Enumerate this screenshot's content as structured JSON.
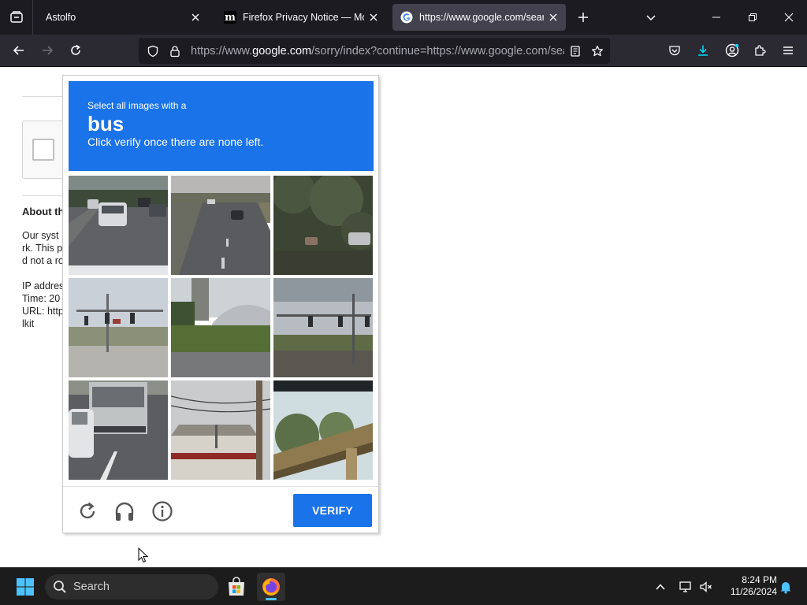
{
  "browser": {
    "tabs": [
      {
        "title": "Astolfo",
        "active": false
      },
      {
        "title": "Firefox Privacy Notice — Mozilla",
        "active": false
      },
      {
        "title": "https://www.google.com/search",
        "active": true
      }
    ],
    "url": {
      "prefix": "https://www.",
      "host": "google.com",
      "path": "/sorry/index?continue=https://www.google.com/search"
    }
  },
  "page_behind": {
    "heading": "About th",
    "lines": [
      "Our syst",
      "rk. This p",
      "d not a ro"
    ],
    "info_lines": [
      "IP addres",
      "Time: 20",
      "URL: http",
      "lkit"
    ]
  },
  "captcha": {
    "header": {
      "prompt": "Select all images with a",
      "target": "bus",
      "instruction": "Click verify once there are none left."
    },
    "tiles": [
      {
        "content": "street with cars"
      },
      {
        "content": "highway road"
      },
      {
        "content": "trees and cars"
      },
      {
        "content": "traffic lights intersection"
      },
      {
        "content": "grass and building"
      },
      {
        "content": "traffic lights street"
      },
      {
        "content": "bus rear"
      },
      {
        "content": "utility pole building"
      },
      {
        "content": "bridge overpass"
      }
    ],
    "footer": {
      "reload_icon": "reload-icon",
      "audio_icon": "headphones-icon",
      "info_icon": "info-icon",
      "verify_label": "VERIFY"
    },
    "colors": {
      "accent": "#1a73e8"
    }
  },
  "taskbar": {
    "search_label": "Search",
    "time": "8:24 PM",
    "date": "11/26/2024"
  }
}
